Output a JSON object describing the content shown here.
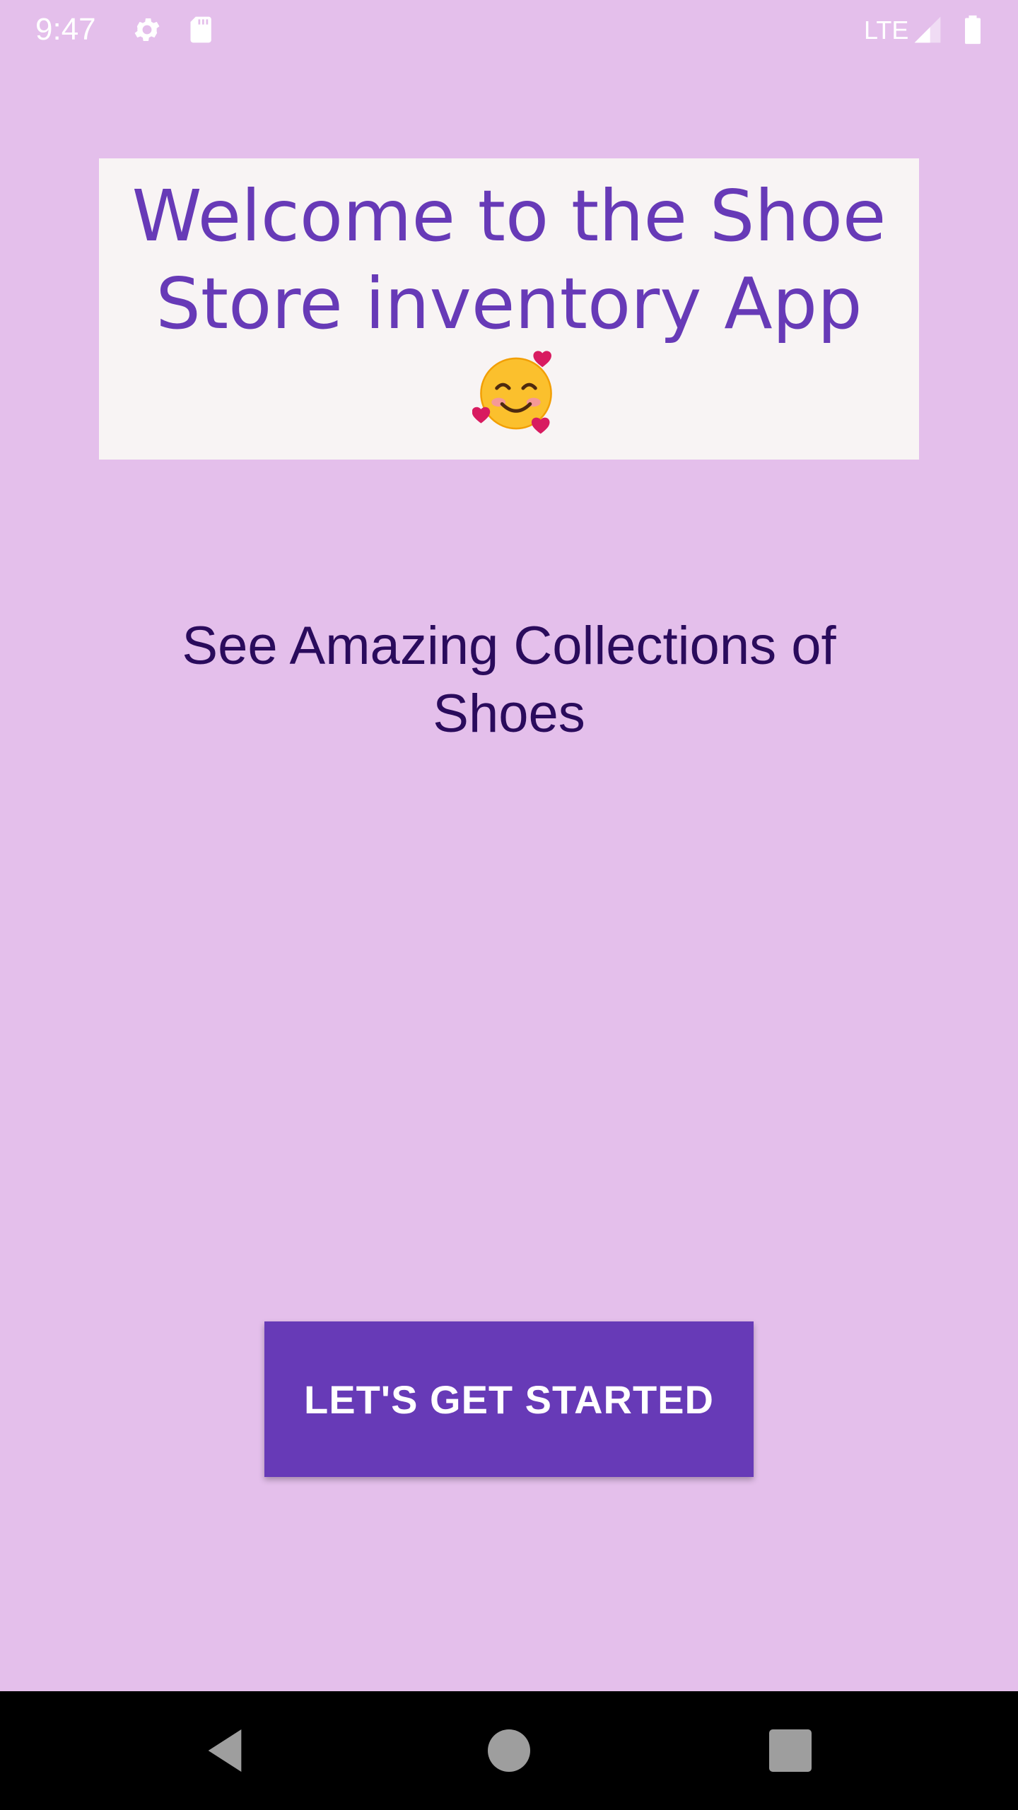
{
  "status_bar": {
    "time": "9:47",
    "network": "LTE",
    "icons": [
      "gear-icon",
      "sd-card-icon",
      "signal-icon",
      "battery-icon"
    ]
  },
  "welcome": {
    "title": "Welcome to the Shoe Store inventory App",
    "emoji": "smiling-face-with-hearts-icon"
  },
  "subtitle": "See Amazing Collections of Shoes",
  "start_button": {
    "label": "LET'S GET STARTED"
  },
  "nav_bar": {
    "icons": [
      "back-icon",
      "home-icon",
      "recents-icon"
    ]
  },
  "colors": {
    "background": "#E4BFEB",
    "card": "#F8F4F4",
    "accent": "#673AB7",
    "subtitle": "#2A0B5C",
    "nav": "#000000"
  }
}
